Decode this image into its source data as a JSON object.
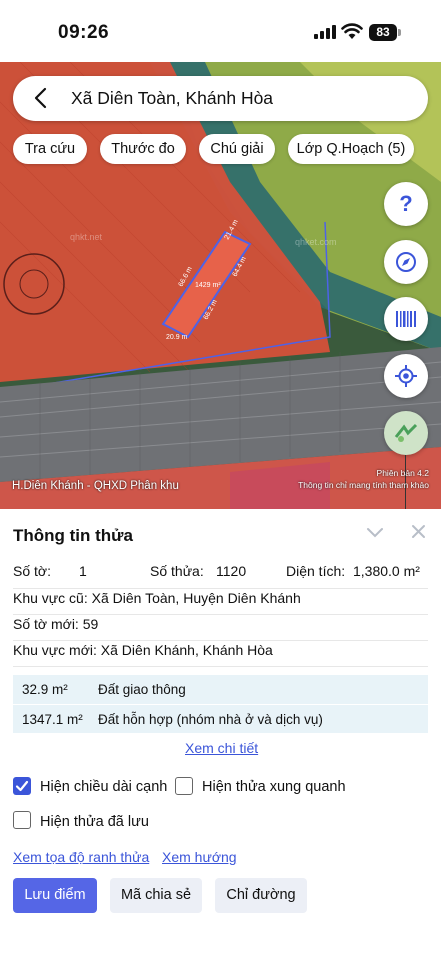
{
  "status_bar": {
    "time": "09:26",
    "battery": "83"
  },
  "search": {
    "location": "Xã Diên Toàn, Khánh Hòa"
  },
  "map_chips": [
    {
      "label": "Tra cứu"
    },
    {
      "label": "Thước đo"
    },
    {
      "label": "Chú giải"
    },
    {
      "label": "Lớp Q.Hoạch (5)"
    }
  ],
  "map": {
    "parcel_area_label": "1429 m²",
    "edge_labels": [
      "21.4 m",
      "66.6 m",
      "64.4 m",
      "20.9 m",
      "66.2 m"
    ],
    "watermarks": [
      "qhkt.net",
      "qhket.com"
    ],
    "layer_label": "H.Diên Khánh - QHXD Phân khu",
    "version_label": "Phiên bản 4.2",
    "disclaimer": "Thông tin chỉ mang tính tham khảo"
  },
  "panel": {
    "title": "Thông tin thửa",
    "so_to_label": "Số tờ:",
    "so_to_value": "1",
    "so_thua_label": "Số thửa:",
    "so_thua_value": "1120",
    "dien_tich_label": "Diện tích:",
    "dien_tich_value": "1,380.0 m²",
    "khu_vuc_cu": "Khu vực cũ: Xã Diên Toàn, Huyện Diên Khánh",
    "so_to_moi": "Số tờ mới: 59",
    "khu_vuc_moi": "Khu vực mới: Xã Diên Khánh, Khánh Hòa",
    "land_types": [
      {
        "area": "32.9 m²",
        "type": "Đất giao thông"
      },
      {
        "area": "1347.1 m²",
        "type": "Đất hỗn hợp (nhóm nhà ở và dịch vụ)"
      }
    ],
    "xem_chi_tiet": "Xem chi tiết",
    "options": [
      {
        "label": "Hiện chiều dài cạnh",
        "checked": true
      },
      {
        "label": "Hiện thửa xung quanh",
        "checked": false
      },
      {
        "label": "Hiện thửa đã lưu",
        "checked": false
      }
    ],
    "link_toa_do": "Xem tọa độ ranh thửa",
    "link_huong": "Xem hướng",
    "buttons": {
      "save": "Lưu điểm",
      "share": "Mã chia sẻ",
      "directions": "Chỉ đường"
    }
  },
  "colors": {
    "accent": "#3b55d9",
    "primary_button": "#5566e6",
    "plan_red": "#d9503a",
    "land_table_bg": "#e8f3f8"
  }
}
